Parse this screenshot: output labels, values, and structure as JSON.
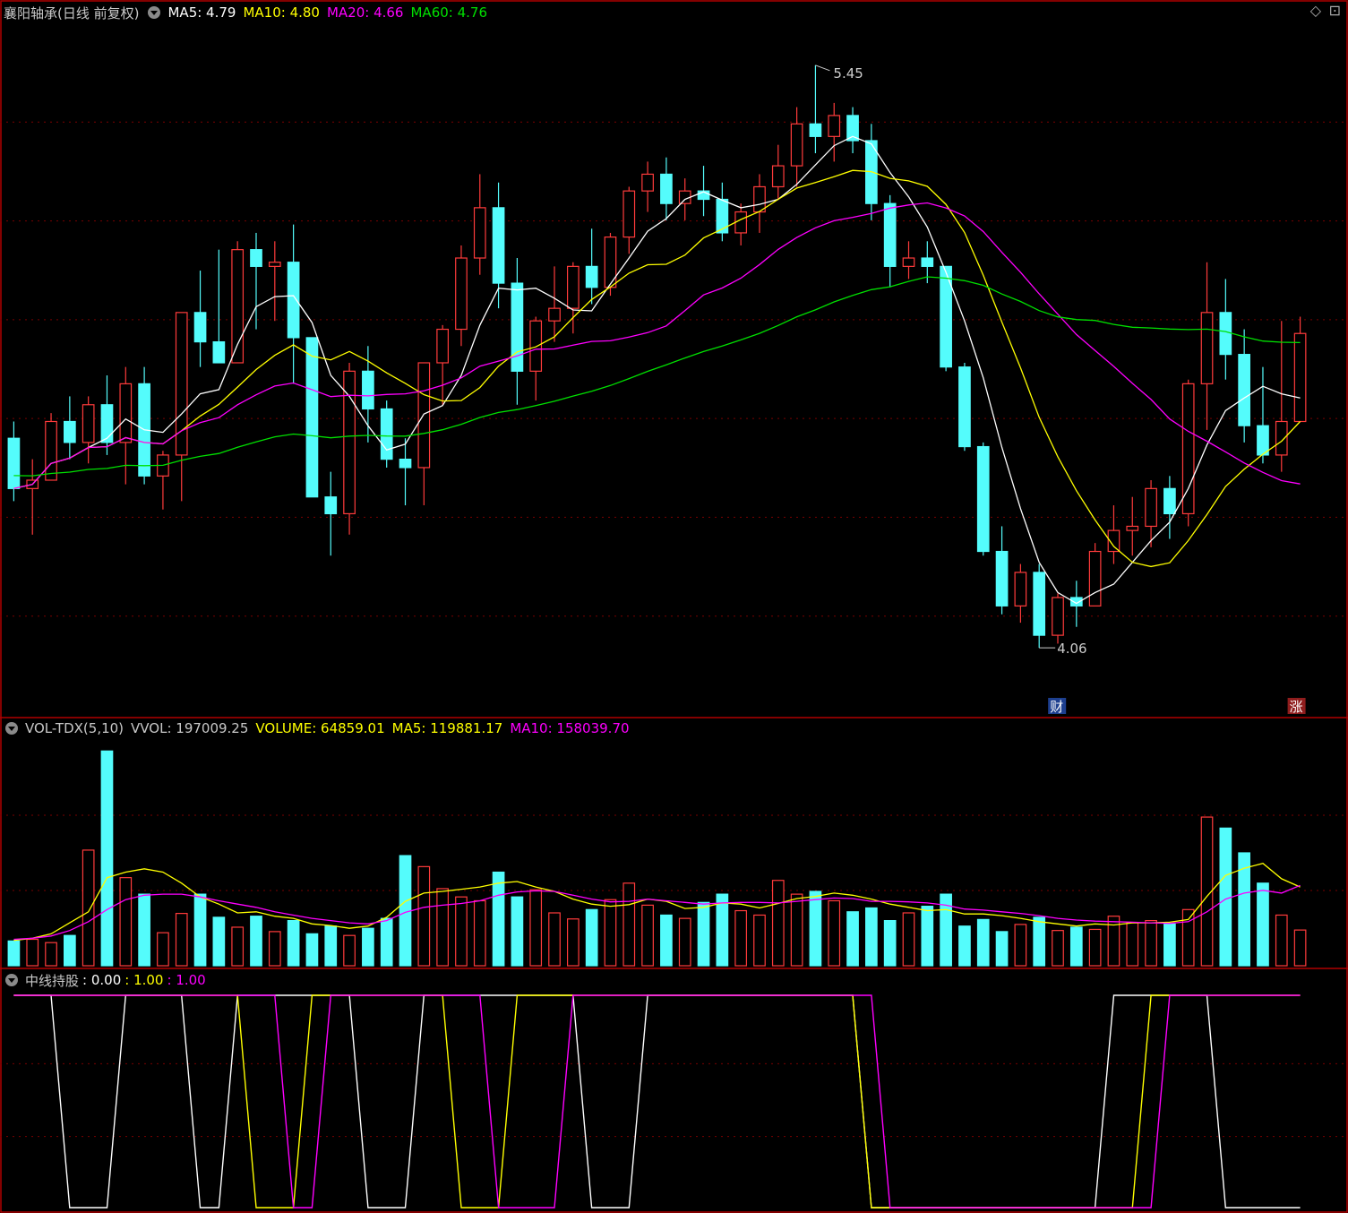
{
  "header": {
    "title": "襄阳轴承(日线 前复权)",
    "ma5": "MA5: 4.79",
    "ma10": "MA10: 4.80",
    "ma20": "MA20: 4.66",
    "ma60": "MA60: 4.76"
  },
  "volume_header": {
    "name": "VOL-TDX(5,10)",
    "vvol": "VVOL: 197009.25",
    "volume": "VOLUME: 64859.01",
    "ma5": "MA5: 119881.17",
    "ma10": "MA10: 158039.70"
  },
  "indicator_header": {
    "name": "中线持股",
    "v1": ": 0.00",
    "v2": ": 1.00",
    "v3": ": 1.00"
  },
  "labels": {
    "high": "5.45",
    "low": "4.06",
    "tag_cai": "财",
    "tag_zhang": "涨"
  },
  "colors": {
    "up": "#ff3b3b",
    "down": "#54fcfc",
    "ma5": "#ffffff",
    "ma10": "#ffff00",
    "ma20": "#ff00ff",
    "ma60": "#00e000",
    "grid": "#7a0000",
    "border": "#b00000"
  },
  "chart_data": [
    {
      "type": "candlestick",
      "title": "襄阳轴承(日线 前复权)",
      "y_range": [
        3.9,
        5.55
      ],
      "ohlc": [
        [
          4.56,
          4.6,
          4.41,
          4.44
        ],
        [
          4.44,
          4.51,
          4.33,
          4.46
        ],
        [
          4.46,
          4.62,
          4.46,
          4.6
        ],
        [
          4.6,
          4.66,
          4.51,
          4.55
        ],
        [
          4.55,
          4.66,
          4.5,
          4.64
        ],
        [
          4.64,
          4.71,
          4.52,
          4.55
        ],
        [
          4.55,
          4.73,
          4.45,
          4.69
        ],
        [
          4.69,
          4.73,
          4.45,
          4.47
        ],
        [
          4.47,
          4.53,
          4.39,
          4.52
        ],
        [
          4.52,
          4.86,
          4.41,
          4.86
        ],
        [
          4.86,
          4.96,
          4.73,
          4.79
        ],
        [
          4.79,
          5.01,
          4.74,
          4.74
        ],
        [
          4.74,
          5.03,
          4.74,
          5.01
        ],
        [
          5.01,
          5.05,
          4.82,
          4.97
        ],
        [
          4.97,
          5.03,
          4.84,
          4.98
        ],
        [
          4.98,
          5.07,
          4.69,
          4.8
        ],
        [
          4.8,
          4.8,
          4.42,
          4.42
        ],
        [
          4.42,
          4.48,
          4.28,
          4.38
        ],
        [
          4.38,
          4.74,
          4.33,
          4.72
        ],
        [
          4.72,
          4.78,
          4.55,
          4.63
        ],
        [
          4.63,
          4.65,
          4.49,
          4.51
        ],
        [
          4.51,
          4.56,
          4.4,
          4.49
        ],
        [
          4.49,
          4.74,
          4.4,
          4.74
        ],
        [
          4.74,
          4.83,
          4.64,
          4.82
        ],
        [
          4.82,
          5.02,
          4.78,
          4.99
        ],
        [
          4.99,
          5.19,
          4.95,
          5.11
        ],
        [
          5.11,
          5.17,
          4.87,
          4.93
        ],
        [
          4.93,
          4.99,
          4.64,
          4.72
        ],
        [
          4.72,
          4.85,
          4.65,
          4.84
        ],
        [
          4.84,
          4.97,
          4.79,
          4.87
        ],
        [
          4.87,
          4.98,
          4.81,
          4.97
        ],
        [
          4.97,
          5.06,
          4.88,
          4.92
        ],
        [
          4.92,
          5.05,
          4.9,
          5.04
        ],
        [
          5.04,
          5.16,
          5.0,
          5.15
        ],
        [
          5.15,
          5.22,
          5.1,
          5.19
        ],
        [
          5.19,
          5.23,
          5.08,
          5.12
        ],
        [
          5.12,
          5.18,
          5.08,
          5.15
        ],
        [
          5.15,
          5.21,
          5.09,
          5.13
        ],
        [
          5.13,
          5.17,
          5.03,
          5.05
        ],
        [
          5.05,
          5.12,
          5.02,
          5.1
        ],
        [
          5.1,
          5.19,
          5.05,
          5.16
        ],
        [
          5.16,
          5.26,
          5.13,
          5.21
        ],
        [
          5.21,
          5.35,
          5.16,
          5.31
        ],
        [
          5.31,
          5.45,
          5.24,
          5.28
        ],
        [
          5.28,
          5.36,
          5.22,
          5.33
        ],
        [
          5.33,
          5.35,
          5.24,
          5.27
        ],
        [
          5.27,
          5.31,
          5.08,
          5.12
        ],
        [
          5.12,
          5.14,
          4.92,
          4.97
        ],
        [
          4.97,
          5.03,
          4.94,
          4.99
        ],
        [
          4.99,
          5.03,
          4.93,
          4.97
        ],
        [
          4.97,
          4.97,
          4.72,
          4.73
        ],
        [
          4.73,
          4.74,
          4.53,
          4.54
        ],
        [
          4.54,
          4.55,
          4.28,
          4.29
        ],
        [
          4.29,
          4.35,
          4.14,
          4.16
        ],
        [
          4.16,
          4.26,
          4.12,
          4.24
        ],
        [
          4.24,
          4.26,
          4.06,
          4.09
        ],
        [
          4.09,
          4.19,
          4.07,
          4.18
        ],
        [
          4.18,
          4.22,
          4.11,
          4.16
        ],
        [
          4.16,
          4.31,
          4.16,
          4.29
        ],
        [
          4.29,
          4.4,
          4.26,
          4.34
        ],
        [
          4.34,
          4.42,
          4.28,
          4.35
        ],
        [
          4.35,
          4.46,
          4.3,
          4.44
        ],
        [
          4.44,
          4.47,
          4.32,
          4.38
        ],
        [
          4.38,
          4.7,
          4.35,
          4.69
        ],
        [
          4.69,
          4.98,
          4.58,
          4.86
        ],
        [
          4.86,
          4.94,
          4.7,
          4.76
        ],
        [
          4.76,
          4.82,
          4.55,
          4.59
        ],
        [
          4.59,
          4.73,
          4.5,
          4.52
        ],
        [
          4.52,
          4.84,
          4.48,
          4.6
        ],
        [
          4.6,
          4.85,
          4.6,
          4.81
        ]
      ],
      "ma_lines": [
        "MA5",
        "MA10",
        "MA20",
        "MA60"
      ],
      "annotations": [
        "5.45",
        "4.06",
        "财",
        "涨"
      ]
    },
    {
      "type": "bar",
      "title": "VOL-TDX(5,10)",
      "y_range": [
        0,
        410000
      ],
      "values": [
        45000,
        48000,
        42000,
        55000,
        210000,
        390000,
        160000,
        130000,
        60000,
        95000,
        130000,
        88000,
        70000,
        90000,
        62000,
        82000,
        58000,
        72000,
        55000,
        68000,
        86000,
        200000,
        180000,
        140000,
        125000,
        118000,
        170000,
        125000,
        138000,
        96000,
        85000,
        102000,
        120000,
        150000,
        110000,
        92000,
        86000,
        115000,
        130000,
        100000,
        92000,
        155000,
        130000,
        135000,
        118000,
        98000,
        105000,
        82000,
        96000,
        108000,
        130000,
        72000,
        84000,
        62000,
        75000,
        88000,
        64000,
        70000,
        66000,
        90000,
        78000,
        82000,
        76000,
        102000,
        270000,
        250000,
        205000,
        150000,
        92000,
        64859
      ],
      "series": [
        {
          "name": "MA5",
          "values": [
            46000,
            50000,
            58000,
            78000,
            98000,
            160000,
            170000,
            176000,
            170000,
            150000,
            125000,
            112000,
            96000,
            98000,
            90000,
            86000,
            76000,
            73000,
            68000,
            72000,
            88000,
            117000,
            132000,
            135000,
            139000,
            143000,
            150000,
            153000,
            143000,
            135000,
            121000,
            112000,
            108000,
            111000,
            121000,
            117000,
            104000,
            106000,
            114000,
            112000,
            105000,
            113000,
            122000,
            126000,
            132000,
            128000,
            121000,
            112000,
            106000,
            100000,
            102000,
            94000,
            94000,
            91000,
            86000,
            80000,
            76000,
            72000,
            76000,
            74000,
            78000,
            78000,
            79000,
            84000,
            126000,
            164000,
            177000,
            186000,
            158000,
            143000
          ]
        },
        {
          "name": "MA10",
          "values": [
            48000,
            50000,
            54000,
            64000,
            80000,
            102000,
            120000,
            128000,
            130000,
            130000,
            125000,
            118000,
            112000,
            106000,
            98000,
            92000,
            86000,
            82000,
            78000,
            76000,
            82000,
            97000,
            106000,
            110000,
            113000,
            118000,
            128000,
            134000,
            136000,
            135000,
            128000,
            121000,
            116000,
            117000,
            121000,
            118000,
            115000,
            112000,
            114000,
            115000,
            115000,
            114000,
            117000,
            120000,
            123000,
            122000,
            117000,
            117000,
            116000,
            114000,
            110000,
            103000,
            101000,
            98000,
            95000,
            91000,
            86000,
            83000,
            81000,
            80000,
            79000,
            78000,
            77000,
            80000,
            98000,
            121000,
            132000,
            137000,
            132000,
            146000
          ]
        }
      ]
    },
    {
      "type": "line",
      "title": "中线持股",
      "y_range": [
        0,
        1
      ],
      "series": [
        {
          "name": "",
          "values": [
            1,
            1,
            1,
            0,
            0,
            0,
            1,
            1,
            1,
            1,
            0,
            0,
            1,
            1,
            1,
            1,
            1,
            1,
            1,
            0,
            0,
            0,
            1,
            1,
            1,
            1,
            1,
            1,
            1,
            1,
            1,
            0,
            0,
            0,
            1,
            1,
            1,
            1,
            1,
            1,
            1,
            1,
            1,
            1,
            1,
            1,
            0,
            0,
            0,
            0,
            0,
            0,
            0,
            0,
            0,
            0,
            0,
            0,
            0,
            1,
            1,
            1,
            1,
            1,
            1,
            0,
            0,
            0,
            0,
            0
          ]
        },
        {
          "name": "",
          "values": [
            1,
            1,
            1,
            1,
            1,
            1,
            1,
            1,
            1,
            1,
            1,
            1,
            1,
            0,
            0,
            0,
            1,
            1,
            1,
            1,
            1,
            1,
            1,
            1,
            0,
            0,
            0,
            1,
            1,
            1,
            1,
            1,
            1,
            1,
            1,
            1,
            1,
            1,
            1,
            1,
            1,
            1,
            1,
            1,
            1,
            1,
            0,
            0,
            0,
            0,
            0,
            0,
            0,
            0,
            0,
            0,
            0,
            0,
            0,
            0,
            0,
            1,
            1,
            1,
            1,
            1,
            1,
            1,
            1,
            1
          ]
        },
        {
          "name": "",
          "values": [
            1,
            1,
            1,
            1,
            1,
            1,
            1,
            1,
            1,
            1,
            1,
            1,
            1,
            1,
            1,
            0,
            0,
            1,
            1,
            1,
            1,
            1,
            1,
            1,
            1,
            1,
            0,
            0,
            0,
            0,
            1,
            1,
            1,
            1,
            1,
            1,
            1,
            1,
            1,
            1,
            1,
            1,
            1,
            1,
            1,
            1,
            1,
            0,
            0,
            0,
            0,
            0,
            0,
            0,
            0,
            0,
            0,
            0,
            0,
            0,
            0,
            0,
            1,
            1,
            1,
            1,
            1,
            1,
            1,
            1
          ]
        }
      ]
    }
  ]
}
